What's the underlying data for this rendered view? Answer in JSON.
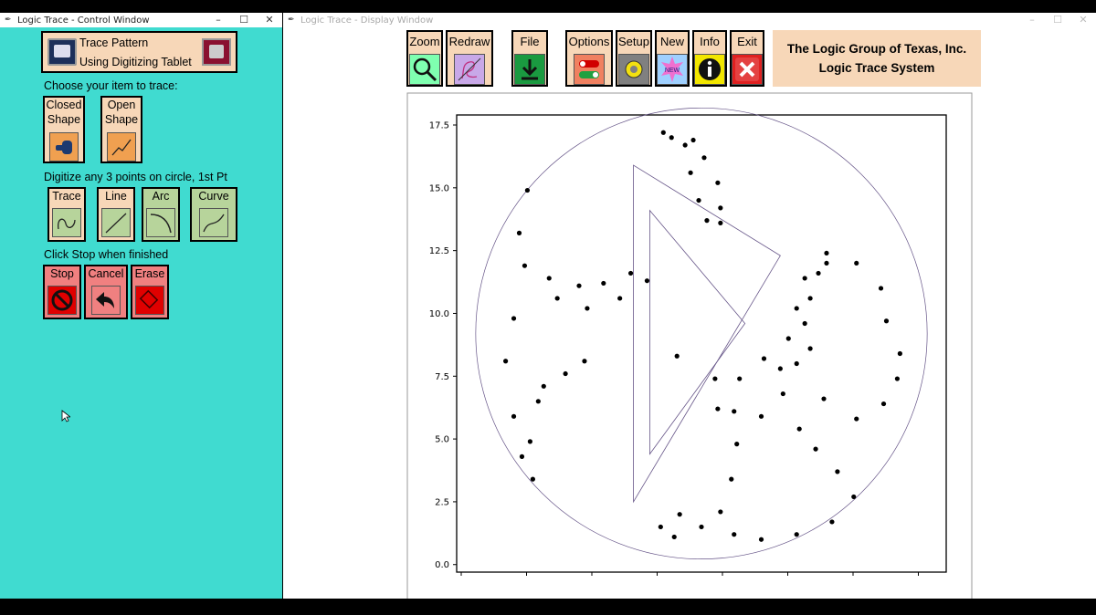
{
  "control_window": {
    "title": "Logic Trace - Control Window",
    "tablet_line1": "Trace Pattern",
    "tablet_line2": "Using Digitizing Tablet",
    "choose_label": "Choose your item to trace:",
    "closed_shape": [
      "Closed",
      "Shape"
    ],
    "open_shape": [
      "Open",
      "Shape"
    ],
    "digitize_label": "Digitize any 3 points on circle, 1st Pt",
    "trace": "Trace",
    "line": "Line",
    "arc": "Arc",
    "curve": "Curve",
    "stop_label": "Click Stop when finished",
    "stop": "Stop",
    "cancel": "Cancel",
    "erase": "Erase"
  },
  "display_window": {
    "title": "Logic Trace - Display Window",
    "toolbar": {
      "zoom": "Zoom",
      "redraw": "Redraw",
      "file": "File",
      "options": "Options",
      "setup": "Setup",
      "new": "New",
      "new_badge": "NEW",
      "info": "Info",
      "exit": "Exit"
    },
    "company_line1": "The Logic Group of Texas, Inc.",
    "company_line2": "Logic Trace System"
  },
  "window_controls": {
    "minimize": "–",
    "maximize": "☐",
    "close": "✕"
  },
  "icons": [
    "tablet-icon",
    "digitizer-icon",
    "closed-shape-icon",
    "open-shape-icon",
    "trace-icon",
    "line-icon",
    "arc-icon",
    "curve-icon",
    "stop-icon",
    "undo-arrow-icon",
    "erase-icon",
    "magnifier-icon",
    "redraw-icon",
    "download-icon",
    "toggle-icon",
    "gear-icon",
    "new-badge-icon",
    "info-icon",
    "close-x-icon",
    "mouse-cursor-icon"
  ],
  "chart_data": {
    "type": "scatter",
    "title": "",
    "xlabel": "",
    "ylabel": "",
    "ylim": [
      -0.3,
      17.9
    ],
    "y_ticks": [
      "0.0",
      "2.5",
      "5.0",
      "7.5",
      "10.0",
      "12.5",
      "15.0",
      "17.5"
    ],
    "x_ticks_visible": false,
    "grid": false,
    "description_series": "digitized trace points of a circular pattern with three crescent cut-outs and a central triangle",
    "triangle_outline": [
      [
        6.5,
        15.9
      ],
      [
        11.9,
        12.3
      ],
      [
        6.5,
        2.5
      ]
    ],
    "inner_triangle": [
      [
        7.1,
        14.1
      ],
      [
        10.6,
        9.6
      ],
      [
        7.1,
        4.4
      ]
    ],
    "crescent_points": [
      [
        7.6,
        17.2
      ],
      [
        8.4,
        16.7
      ],
      [
        8.6,
        15.6
      ],
      [
        8.9,
        14.5
      ],
      [
        9.2,
        13.7
      ],
      [
        9.7,
        13.6
      ],
      [
        9.7,
        14.2
      ],
      [
        9.6,
        15.2
      ],
      [
        9.1,
        16.2
      ],
      [
        8.7,
        16.9
      ],
      [
        7.9,
        17.0
      ],
      [
        2.6,
        14.9
      ],
      [
        2.3,
        13.2
      ],
      [
        2.5,
        11.9
      ],
      [
        3.4,
        11.4
      ],
      [
        4.5,
        11.1
      ],
      [
        5.4,
        11.2
      ],
      [
        6.4,
        11.6
      ],
      [
        7.0,
        11.3
      ],
      [
        6.0,
        10.6
      ],
      [
        4.8,
        10.2
      ],
      [
        3.7,
        10.6
      ],
      [
        2.1,
        9.8
      ],
      [
        1.8,
        8.1
      ],
      [
        2.1,
        5.9
      ],
      [
        2.4,
        4.3
      ],
      [
        2.8,
        3.4
      ],
      [
        2.7,
        4.9
      ],
      [
        3.0,
        6.5
      ],
      [
        4.0,
        7.6
      ],
      [
        4.7,
        8.1
      ],
      [
        3.2,
        7.1
      ],
      [
        8.1,
        8.3
      ],
      [
        9.5,
        7.4
      ],
      [
        10.2,
        6.1
      ],
      [
        10.3,
        4.8
      ],
      [
        10.1,
        3.4
      ],
      [
        9.7,
        2.1
      ],
      [
        9.0,
        1.5
      ],
      [
        8.0,
        1.1
      ],
      [
        7.5,
        1.5
      ],
      [
        8.2,
        2.0
      ],
      [
        15.6,
        11.0
      ],
      [
        14.7,
        12.0
      ],
      [
        13.6,
        12.4
      ],
      [
        12.8,
        11.4
      ],
      [
        12.5,
        10.2
      ],
      [
        12.2,
        9.0
      ],
      [
        12.5,
        8.0
      ],
      [
        13.5,
        6.6
      ],
      [
        14.7,
        5.8
      ],
      [
        15.7,
        6.4
      ],
      [
        16.2,
        7.4
      ],
      [
        16.3,
        8.4
      ],
      [
        15.8,
        9.7
      ],
      [
        13.6,
        12.0
      ],
      [
        13.3,
        11.6
      ],
      [
        13.0,
        10.6
      ],
      [
        12.8,
        9.6
      ],
      [
        13.0,
        8.6
      ],
      [
        9.6,
        6.2
      ],
      [
        10.4,
        7.4
      ],
      [
        11.3,
        8.2
      ],
      [
        11.9,
        7.8
      ],
      [
        12.0,
        6.8
      ],
      [
        11.2,
        5.9
      ],
      [
        12.6,
        5.4
      ],
      [
        13.2,
        4.6
      ],
      [
        14.0,
        3.7
      ],
      [
        14.6,
        2.7
      ],
      [
        13.8,
        1.7
      ],
      [
        12.5,
        1.2
      ],
      [
        11.2,
        1.0
      ],
      [
        10.2,
        1.2
      ]
    ]
  }
}
